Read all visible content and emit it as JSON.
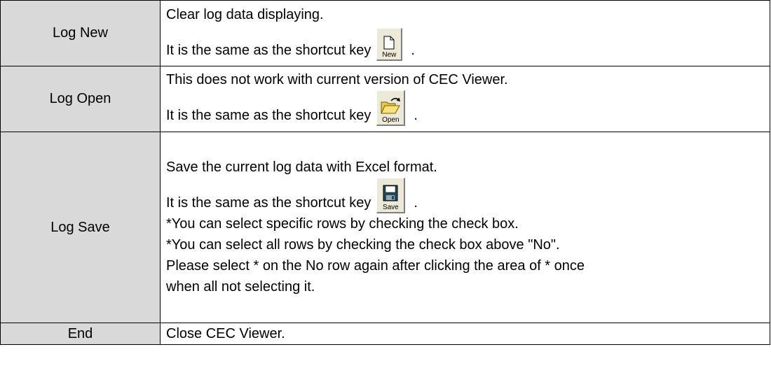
{
  "rows": [
    {
      "label": "Log New",
      "lines": [
        "Clear log data displaying."
      ],
      "shortcut_text": "It is the same as the shortcut key",
      "shortcut_button": "New",
      "shortcut_icon": "new-document-icon",
      "after_lines": []
    },
    {
      "label": "Log Open",
      "lines": [
        "This does not work with current version of CEC Viewer."
      ],
      "shortcut_text": "It is the same as the shortcut key",
      "shortcut_button": "Open",
      "shortcut_icon": "open-folder-icon",
      "after_lines": []
    },
    {
      "label": "Log Save",
      "lines": [
        "Save the current log data with Excel format."
      ],
      "shortcut_text": "It is the same as the shortcut key",
      "shortcut_button": "Save",
      "shortcut_icon": "floppy-disk-icon",
      "after_lines": [
        "*You can select specific rows by checking the check box.",
        "*You can select all rows by checking the check box above \"No\".",
        "Please select * on the No row again after clicking the area of * once",
        "when all not selecting it."
      ]
    },
    {
      "label": "End",
      "lines": [
        "Close CEC Viewer."
      ]
    }
  ],
  "period": "."
}
